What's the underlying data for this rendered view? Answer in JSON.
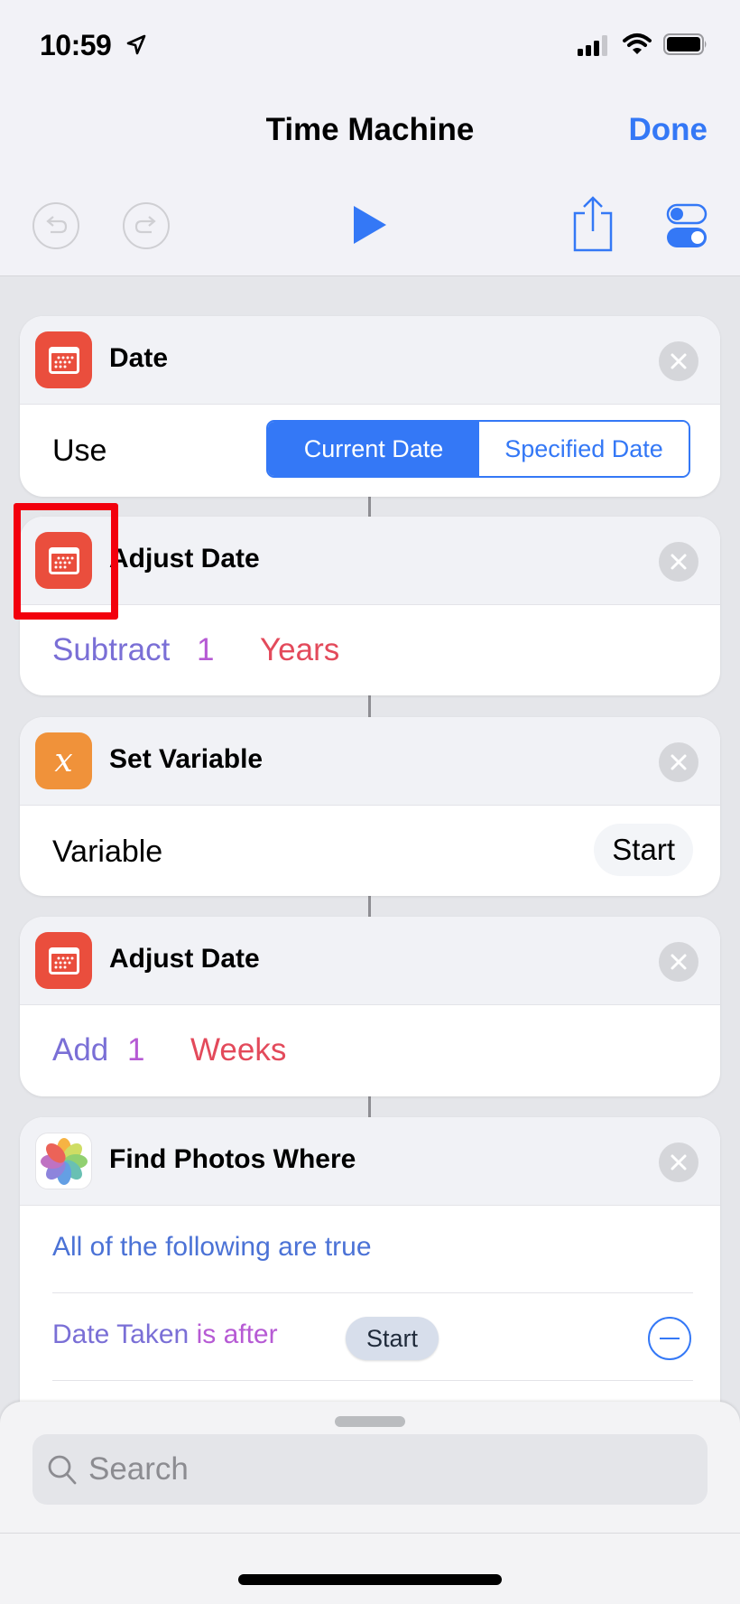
{
  "status_bar": {
    "time": "10:59",
    "location_icon": "location-arrow-icon",
    "signal_icon": "cellular-signal-icon",
    "wifi_icon": "wifi-icon",
    "battery_icon": "battery-icon"
  },
  "nav": {
    "title": "Time Machine",
    "done_label": "Done"
  },
  "toolbar": {
    "undo_icon": "undo-icon",
    "redo_icon": "redo-icon",
    "play_icon": "play-icon",
    "share_icon": "share-icon",
    "settings_icon": "toggles-icon"
  },
  "colors": {
    "accent": "#3478f6",
    "date_action": "#ea4e3d",
    "variable_action": "#f0923a",
    "param_purple": "#7a6fd6",
    "param_magenta": "#b65ad4",
    "param_pink": "#e34a5b",
    "annotation": "#f2000d"
  },
  "actions": [
    {
      "title": "Date",
      "icon": "calendar-icon",
      "label": "Use",
      "segments": [
        {
          "label": "Current Date",
          "selected": true
        },
        {
          "label": "Specified Date",
          "selected": false
        }
      ]
    },
    {
      "title": "Adjust Date",
      "icon": "calendar-icon",
      "operation": "Subtract",
      "amount": "1",
      "unit": "Years",
      "highlighted": true
    },
    {
      "title": "Set Variable",
      "icon": "variable-x-icon",
      "label": "Variable",
      "value": "Start"
    },
    {
      "title": "Adjust Date",
      "icon": "calendar-icon",
      "operation": "Add",
      "amount": "1",
      "unit": "Weeks"
    },
    {
      "title": "Find Photos Where",
      "icon": "photos-icon",
      "match_mode": "All of the following are true",
      "filters": [
        {
          "field": "Date Taken",
          "operator": "is after",
          "value": "Start"
        }
      ]
    }
  ],
  "search": {
    "placeholder": "Search",
    "value": ""
  }
}
